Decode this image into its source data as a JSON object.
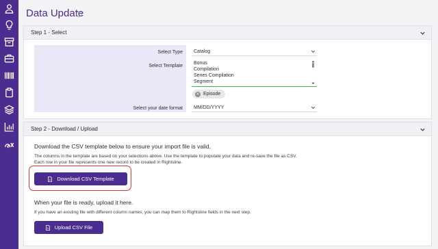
{
  "page": {
    "title": "Data Update"
  },
  "sidenav": {
    "icons": [
      "user-icon",
      "lightbulb-icon",
      "archive-icon",
      "briefcase-icon",
      "barcode-icon",
      "clipboard-icon",
      "layers-icon",
      "bar-chart-icon",
      "brand-icon"
    ]
  },
  "step1": {
    "title": "Step 1 - Select",
    "select_type_label": "Select Type",
    "select_type_value": "Catalog",
    "select_template_label": "Select Template",
    "template_options": [
      "Bonus",
      "Compilation",
      "Series Compilation",
      "Segment"
    ],
    "selected_chip": "Episode",
    "date_format_label": "Select your date format",
    "date_format_value": "MM/DD/YYYY"
  },
  "step2": {
    "title": "Step 2 - Download / Upload",
    "download_heading": "Download the CSV template below to ensure your import file is valid.",
    "download_text_1": "The columns in the template are based on your selections above. Use the template to populate your data and re-save the file as CSV.",
    "download_text_2": "Each row in your file represents one new record to be created in Rightsline.",
    "download_button": "Download CSV Template",
    "upload_heading": "When your file is ready, upload it here.",
    "upload_text": "If you have an existing file with different column names, you can map them to Rightsline fields in the next step.",
    "upload_button": "Upload CSV File"
  },
  "colors": {
    "brand": "#4a2d8f",
    "highlight": "#d93535",
    "valid": "#4caf50"
  }
}
